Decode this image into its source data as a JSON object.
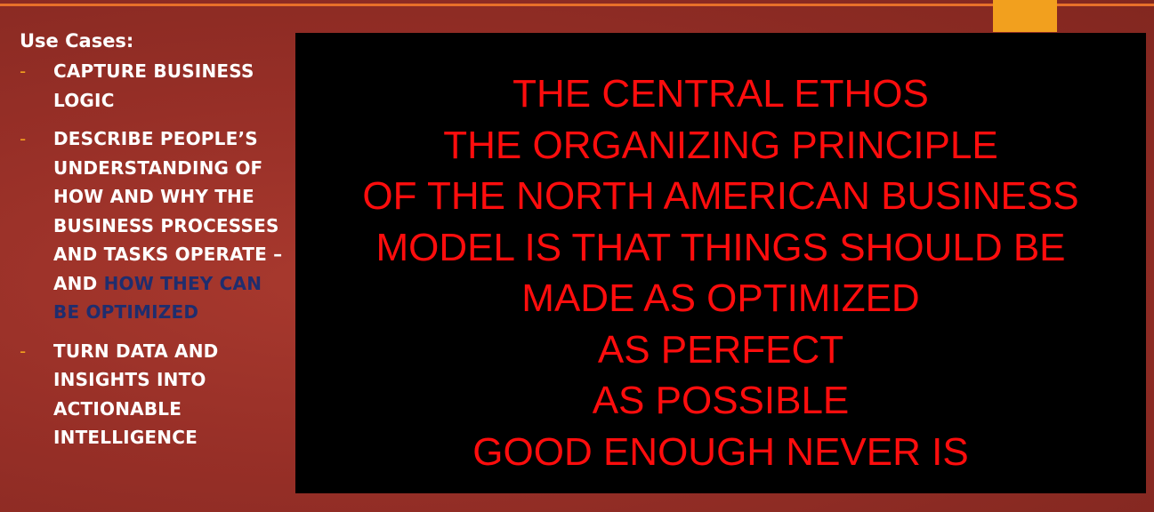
{
  "colors": {
    "background": "#972f27",
    "top_rule": "#e8702a",
    "accent_tab": "#f2a01e",
    "bullet_dash": "#f2a01e",
    "highlight_text": "#1f2d6e",
    "panel_background": "#000000",
    "quote_text": "#ff0d0d"
  },
  "left_panel": {
    "heading": "Use Cases:",
    "bullets": [
      {
        "dash": "-",
        "text": "CAPTURE BUSINESS LOGIC"
      },
      {
        "dash": "-",
        "text": "DESCRIBE PEOPLE’S UNDERSTANDING OF HOW AND WHY THE BUSINESS PROCESSES AND TASKS OPERATE – AND ",
        "highlight": "HOW THEY CAN BE OPTIMIZED"
      },
      {
        "dash": "-",
        "text": "TURN DATA AND INSIGHTS INTO ACTIONABLE INTELLIGENCE"
      }
    ]
  },
  "main_panel": {
    "lines": [
      "THE CENTRAL ETHOS",
      "THE ORGANIZING PRINCIPLE",
      "OF THE NORTH AMERICAN BUSINESS",
      "MODEL IS THAT THINGS SHOULD BE",
      "MADE AS OPTIMIZED",
      "AS PERFECT",
      "AS POSSIBLE",
      "GOOD ENOUGH NEVER IS"
    ]
  }
}
